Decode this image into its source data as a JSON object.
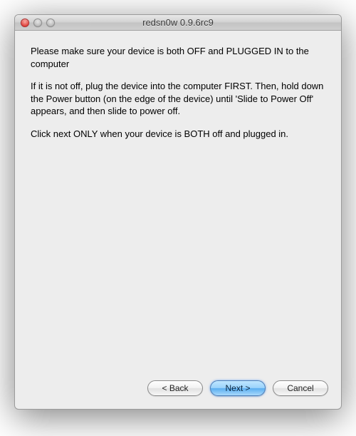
{
  "window": {
    "title": "redsn0w 0.9.6rc9"
  },
  "content": {
    "para1": "Please make sure your device is both OFF and PLUGGED IN to the computer",
    "para2": "If it is not off, plug the device into the computer FIRST. Then, hold down the Power button (on the edge of the device) until 'Slide to Power Off' appears, and then slide to power off.",
    "para3": "Click next ONLY when your device is BOTH off and plugged in."
  },
  "buttons": {
    "back": "< Back",
    "next": "Next >",
    "cancel": "Cancel"
  }
}
